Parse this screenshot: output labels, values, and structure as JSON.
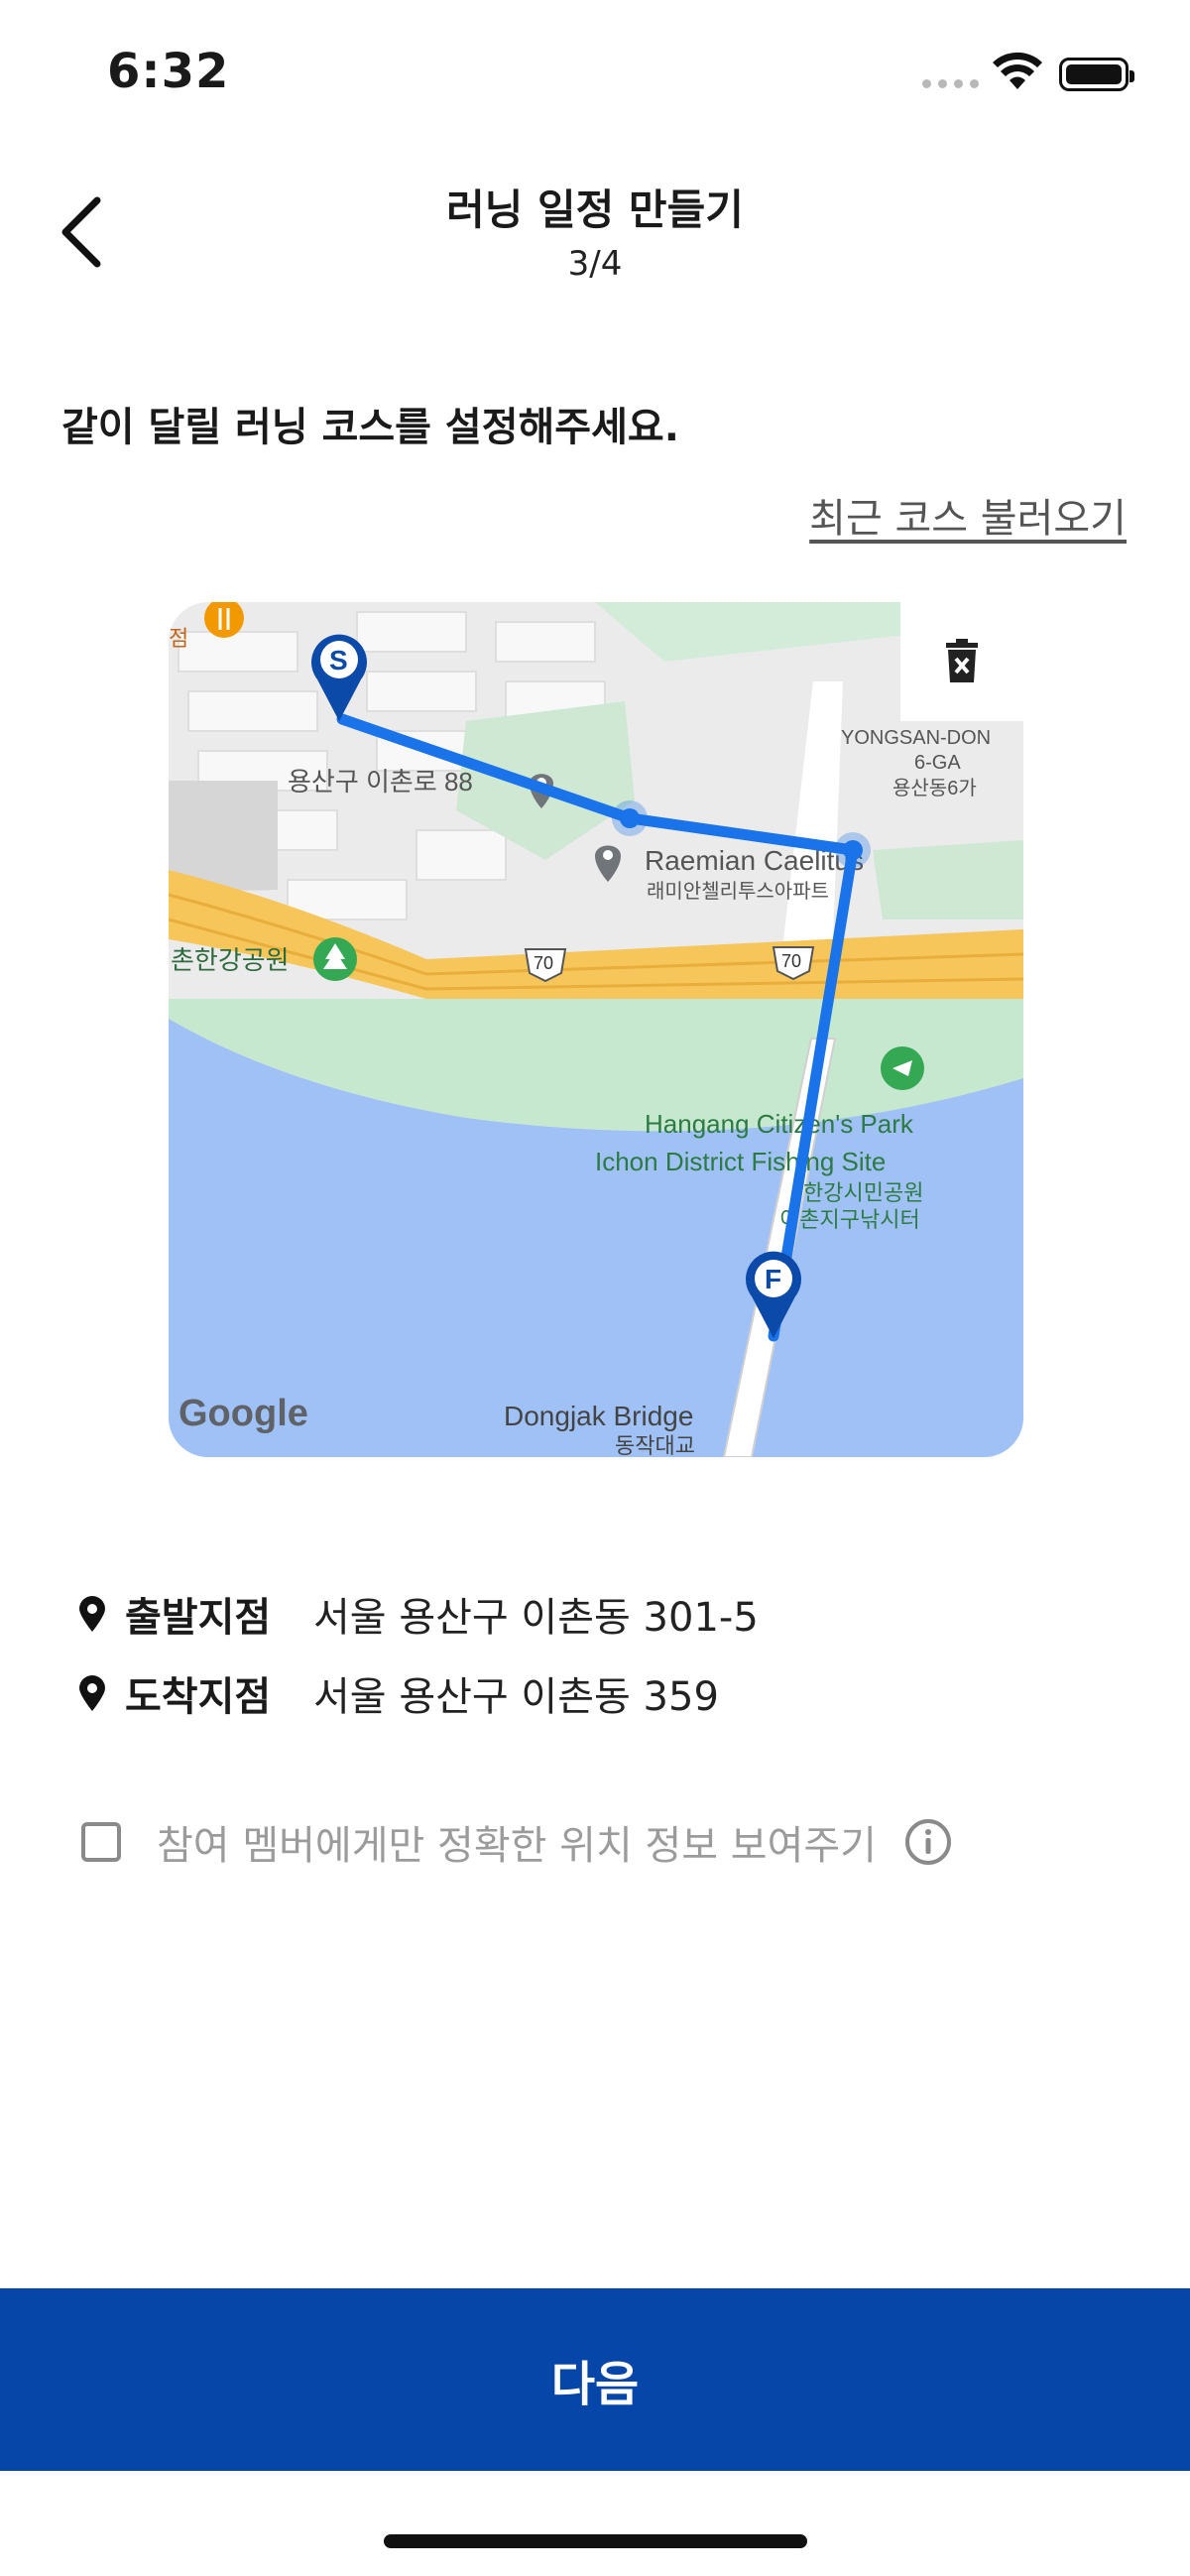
{
  "status_bar": {
    "time": "6:32"
  },
  "header": {
    "title": "러닝 일정 만들기",
    "step": "3/4"
  },
  "main": {
    "heading": "같이 달릴 러닝 코스를 설정해주세요.",
    "recent_course_link": "최근 코스 불러오기"
  },
  "map": {
    "labels": {
      "address_88": "용산구 이촌로 88",
      "raemian_en": "Raemian Caelitus",
      "raemian_ko": "래미안첼리투스아파트",
      "park_left": "촌한강공원",
      "yongsan_en1": "YONGSAN-DON",
      "yongsan_en2": "6-GA",
      "yongsan_ko": "용산동6가",
      "route_70a": "70",
      "route_70b": "70",
      "park_en1": "Hangang Citizen's Park",
      "park_en2": "Ichon District Fishing Site",
      "park_ko1": "한강시민공원",
      "park_ko2": "이촌지구낚시터",
      "bridge_en": "Dongjak Bridge",
      "bridge_ko": "동작대교",
      "google": "Google",
      "start_marker": "S",
      "finish_marker": "F",
      "corner_label": "점"
    },
    "colors": {
      "route": "#1a73e8",
      "marker": "#0b4aa8",
      "water": "#9fc1f6",
      "park": "#c6e8cf",
      "highway": "#f6c65b"
    }
  },
  "locations": [
    {
      "label": "출발지점",
      "value": "서울 용산구 이촌동 301-5"
    },
    {
      "label": "도착지점",
      "value": "서울 용산구 이촌동 359"
    }
  ],
  "privacy_option": {
    "label": "참여 멤버에게만 정확한 위치 정보 보여주기",
    "checked": false
  },
  "next_button": {
    "label": "다음"
  },
  "icons": [
    "back-chevron-icon",
    "trash-icon",
    "location-pin-icon",
    "info-icon",
    "wifi-icon",
    "battery-icon"
  ]
}
